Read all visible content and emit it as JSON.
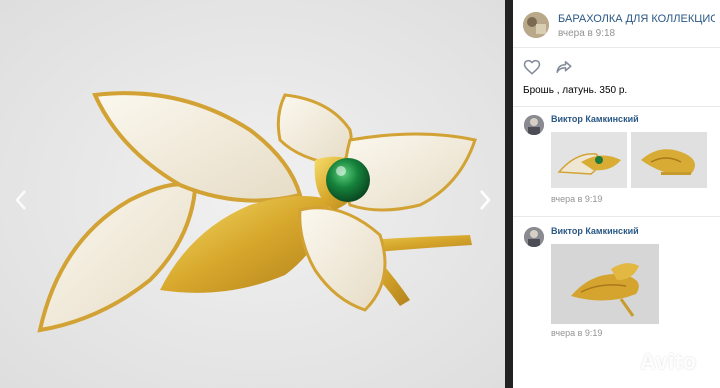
{
  "viewer": {
    "prev_icon": "chevron-left-icon",
    "next_icon": "chevron-right-icon",
    "photo_subject": "brooch-photo"
  },
  "post": {
    "group_name": "БАРАХОЛКА ДЛЯ КОЛЛЕКЦИОНЕР...",
    "time": "вчера в 9:18",
    "description": "Брошь , латунь. 350 р.",
    "like_icon": "heart-icon",
    "share_icon": "share-icon"
  },
  "comments": [
    {
      "author": "Виктор Камкинский",
      "time": "вчера в 9:19"
    },
    {
      "author": "Виктор Камкинский",
      "time": "вчера в 9:19"
    }
  ],
  "watermark": {
    "brand": "Avito"
  },
  "colors": {
    "link": "#2a5885",
    "muted": "#939393",
    "gold": "#d8b13a",
    "jade": "#1e7a3a",
    "cream": "#f2ede0"
  }
}
